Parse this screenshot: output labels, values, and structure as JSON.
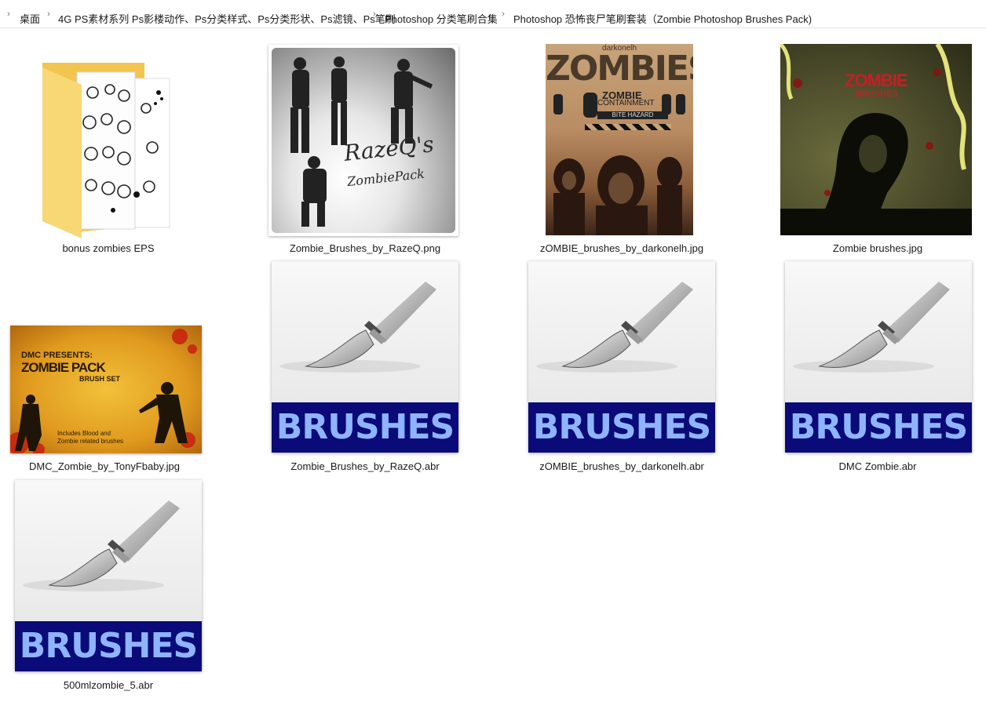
{
  "breadcrumb": {
    "items": [
      "桌面",
      "4G PS素材系列 Ps影楼动作、Ps分类样式、Ps分类形状、Ps滤镜、Ps笔刷",
      "Photoshop 分类笔刷合集",
      "Photoshop 恐怖丧尸笔刷套装（Zombie Photoshop Brushes Pack)"
    ]
  },
  "files": [
    {
      "name": "bonus zombies EPS",
      "type": "folder"
    },
    {
      "name": "Zombie_Brushes_by_RazeQ.png",
      "type": "image",
      "art_title": "RazeQ's",
      "art_subtitle": "ZombiePack"
    },
    {
      "name": "zOMBIE_brushes_by_darkonelh.jpg",
      "type": "image",
      "art_top": "darkonelh",
      "art_title": "ZOMBIES",
      "art_sub1": "ZOMBIE",
      "art_sub2": "CONTAINMENT",
      "art_sub3": "BITE HAZARD"
    },
    {
      "name": "Zombie brushes.jpg",
      "type": "image",
      "art_title": "ZOMBIE",
      "art_subtitle": "BRUSHES"
    },
    {
      "name": "DMC_Zombie_by_TonyFbaby.jpg",
      "type": "image",
      "art_line1": "DMC PRESENTS:",
      "art_line2": "ZOMBIE PACK",
      "art_line3": "BRUSH SET",
      "art_line4": "Includes Blood and",
      "art_line5": "Zombie related brushes"
    },
    {
      "name": "Zombie_Brushes_by_RazeQ.abr",
      "type": "abr",
      "badge": "BRUSHES"
    },
    {
      "name": "zOMBIE_brushes_by_darkonelh.abr",
      "type": "abr",
      "badge": "BRUSHES"
    },
    {
      "name": "DMC Zombie.abr",
      "type": "abr",
      "badge": "BRUSHES"
    },
    {
      "name": "500mlzombie_5.abr",
      "type": "abr",
      "badge": "BRUSHES"
    }
  ],
  "colors": {
    "abr_band": "#0a0a78",
    "abr_text": "#8fb4ff",
    "folder": "#f8d775"
  }
}
